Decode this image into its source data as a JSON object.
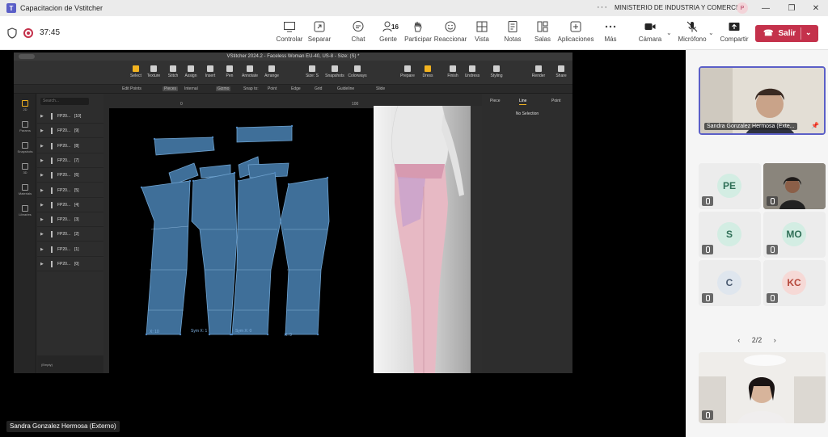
{
  "window": {
    "title": "Capacitacion de Vstitcher",
    "organization": "MINISTERIO DE INDUSTRIA Y COMERCIO",
    "user_initial": "P",
    "more": "···"
  },
  "meeting": {
    "elapsed": "37:45",
    "toolbar": [
      {
        "id": "controlar",
        "label": "Controlar"
      },
      {
        "id": "separar",
        "label": "Separar"
      },
      {
        "id": "chat",
        "label": "Chat"
      },
      {
        "id": "gente",
        "label": "Gente",
        "count": "16"
      },
      {
        "id": "participar",
        "label": "Participar"
      },
      {
        "id": "reaccionar",
        "label": "Reaccionar"
      },
      {
        "id": "vista",
        "label": "Vista"
      },
      {
        "id": "notas",
        "label": "Notas"
      },
      {
        "id": "salas",
        "label": "Salas"
      },
      {
        "id": "aplicaciones",
        "label": "Aplicaciones"
      },
      {
        "id": "mas",
        "label": "Más"
      },
      {
        "id": "camara",
        "label": "Cámara"
      },
      {
        "id": "microfono",
        "label": "Micrófono"
      },
      {
        "id": "compartir",
        "label": "Compartir"
      }
    ],
    "leave_label": "Salir",
    "sharer_label": "Sandra Gonzalez Hermosa (Externo)"
  },
  "vstitcher": {
    "title": "VStitcher 2024.2 - Faceless Woman EU-40, US-8 - Size: (S) *",
    "toolbar": [
      {
        "label": "Select",
        "hot": true
      },
      {
        "label": "Texture",
        "hot": false
      },
      {
        "label": "Stitch",
        "hot": false
      },
      {
        "label": "Assign",
        "hot": false
      },
      {
        "label": "Insert",
        "hot": false
      },
      {
        "label": "Pen",
        "hot": false
      },
      {
        "label": "Annotate",
        "hot": false
      },
      {
        "label": "Arrange",
        "hot": false
      },
      {
        "label": "Size: S",
        "hot": false
      },
      {
        "label": "Snapshots",
        "hot": false
      },
      {
        "label": "Colorways",
        "hot": false
      },
      {
        "label": "Prepare",
        "hot": false
      },
      {
        "label": "Dress",
        "hot": true
      },
      {
        "label": "Finish",
        "hot": false
      },
      {
        "label": "Undress",
        "hot": false
      },
      {
        "label": "Styling",
        "hot": false
      },
      {
        "label": "Render",
        "hot": false
      },
      {
        "label": "Share",
        "hot": false
      }
    ],
    "subbar": {
      "edit_points": "Edit Points",
      "pieces": "Pieces",
      "internal": "Internal",
      "gizmo": "Gizmo",
      "snap_to": "Snap to:",
      "point": "Point",
      "edge": "Edge",
      "grid": "Grid",
      "guideline": "Guideline",
      "slide": "Slide"
    },
    "left_nav": [
      "2D",
      "Params",
      "Snapshots",
      "3D",
      "Materials",
      "Libraries"
    ],
    "search_placeholder": "Search...",
    "pieces": [
      {
        "name": "FP20...",
        "index": "[10]"
      },
      {
        "name": "FP20...",
        "index": "[9]"
      },
      {
        "name": "FP20...",
        "index": "[8]"
      },
      {
        "name": "FP20...",
        "index": "[7]"
      },
      {
        "name": "FP20...",
        "index": "[6]"
      },
      {
        "name": "FP20...",
        "index": "[5]"
      },
      {
        "name": "FP20...",
        "index": "[4]"
      },
      {
        "name": "FP20...",
        "index": "[3]"
      },
      {
        "name": "FP20...",
        "index": "[2]"
      },
      {
        "name": "FP20...",
        "index": "[1]"
      },
      {
        "name": "FP20...",
        "index": "[0]"
      }
    ],
    "ruler": {
      "zero": "0",
      "hundred": "100"
    },
    "canvas_labels": [
      {
        "id": "x10",
        "text": "X: 10"
      },
      {
        "id": "symx1",
        "text": "Sym X: 1"
      },
      {
        "id": "symx0",
        "text": "Sym X: 0"
      },
      {
        "id": "x9",
        "text": "X: 9"
      }
    ],
    "right_tabs": [
      "Piece",
      "Line",
      "Point"
    ],
    "right_active_tab": "Line",
    "no_selection": "No Selection",
    "bottom_label": "(Empty)",
    "accent": "#f2b320",
    "piece_fill": "#3f6f99"
  },
  "participants": {
    "featured_name": "Sandra Gonzalez Hermosa (Exte...",
    "grid": [
      {
        "initials": "PE",
        "bg": "#d3ede3",
        "fg": "#2f6f57"
      },
      {
        "initials": "S",
        "bg": "#d3ede3",
        "fg": "#2f6f57"
      },
      {
        "initials": "MO",
        "bg": "#d3ede3",
        "fg": "#2f6f57"
      },
      {
        "initials": "C",
        "bg": "#dfe6ee",
        "fg": "#4a5a70"
      },
      {
        "initials": "KC",
        "bg": "#f6d9d6",
        "fg": "#b5473a"
      }
    ],
    "pager": "2/2"
  }
}
